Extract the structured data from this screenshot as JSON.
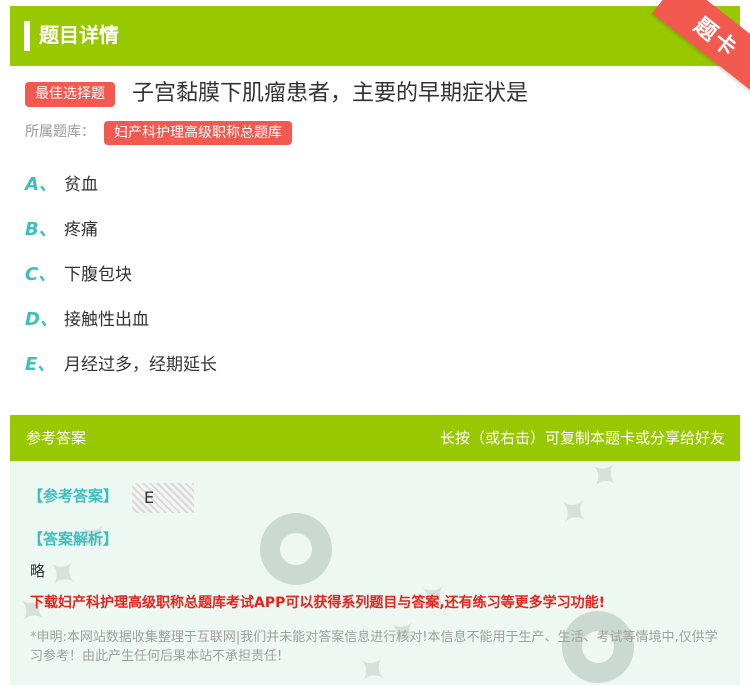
{
  "header": {
    "title": "题目详情"
  },
  "ribbon": {
    "label": "题卡"
  },
  "question": {
    "type_label": "最佳选择题",
    "text": "子宫黏膜下肌瘤患者，主要的早期症状是",
    "bank_label": "所属题库：",
    "bank_name": "妇产科护理高级职称总题库"
  },
  "options": [
    {
      "letter": "A、",
      "text": "贫血"
    },
    {
      "letter": "B、",
      "text": "疼痛"
    },
    {
      "letter": "C、",
      "text": "下腹包块"
    },
    {
      "letter": "D、",
      "text": "接触性出血"
    },
    {
      "letter": "E、",
      "text": "月经过多，经期延长"
    }
  ],
  "answer_panel": {
    "title": "参考答案",
    "hint": "长按（或右击）可复制本题卡或分享给好友",
    "answer_label": "【参考答案】",
    "answer_value": "E",
    "explanation_label": "【答案解析】",
    "explanation": "略",
    "download_text": "下载妇产科护理高级职称总题库考试APP可以获得系列题目与答案,还有练习等更多学习功能!",
    "disclaimer": "*申明:本网站数据收集整理于互联网|我们并未能对答案信息进行核对!本信息不能用于生产、生活、考试等情境中,仅供学习参考！由此产生任何后果本站不承担责任!"
  },
  "colors": {
    "accent_green": "#98c900",
    "accent_red": "#f25a50",
    "option_letter": "#3dbfbf",
    "download_red": "#e8231b"
  }
}
